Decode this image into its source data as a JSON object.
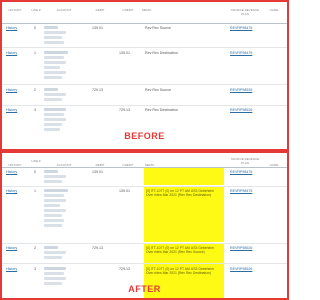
{
  "before": {
    "label": "BEFORE",
    "headers": [
      "HISTORY",
      "LINE #",
      "ACCOUNT",
      "DEBIT",
      "CREDIT",
      "MEMO",
      "SOURCE REVENUE PLAN",
      "NAME"
    ],
    "rows": [
      {
        "history": "History",
        "line": "0",
        "debit": "139.01",
        "credit": "",
        "memo": "Rev Rec Source",
        "plan": "REVRP98475"
      },
      {
        "history": "History",
        "line": "1",
        "debit": "",
        "credit": "139.01",
        "memo": "Rev Rec Destination",
        "plan": "REVRP98475"
      },
      {
        "history": "History",
        "line": "2",
        "debit": "729.13",
        "credit": "",
        "memo": "Rev Rec Source",
        "plan": "REVRP98526"
      },
      {
        "history": "History",
        "line": "3",
        "debit": "",
        "credit": "729.13",
        "memo": "Rev Rec Destination",
        "plan": "REVRP98526"
      }
    ]
  },
  "after": {
    "label": "AFTER",
    "headers": [
      "HISTORY",
      "LINE #",
      "ACCOUNT",
      "DEBIT",
      "CREDIT",
      "MEMO",
      "SOURCE REVENUE PLAN",
      "NAME"
    ],
    "rows": [
      {
        "history": "History",
        "line": "0",
        "debit": "139.01",
        "credit": "",
        "memo": "",
        "plan": "REVRP98475"
      },
      {
        "history": "History",
        "line": "1",
        "debit": "",
        "credit": "139.01",
        "memo": "[0] ITT-1077 (0) ne 12 PT AM US3 Gebeheim Over rides Mar 2021 (Rev Rec Destination)",
        "plan": "REVRP98475"
      },
      {
        "history": "History",
        "line": "2",
        "debit": "729.13",
        "credit": "",
        "memo": "[0] ITT-1077 (0) ne 12 PT AM US3 Gebeheim Over rides Mar 2021 (Rev Rec Source)",
        "plan": "REVRP98526"
      },
      {
        "history": "History",
        "line": "3",
        "debit": "",
        "credit": "729.13",
        "memo": "[0] ITT-1077 (0) ne 12 PT AM US3 Gebeheim Over rides Mar 2021 (Rev Rec Destination)",
        "plan": "REVRP98526"
      }
    ]
  },
  "colors": {
    "border": "#e53935",
    "memo_highlight": "#fffa14",
    "link": "#2e6da4"
  }
}
